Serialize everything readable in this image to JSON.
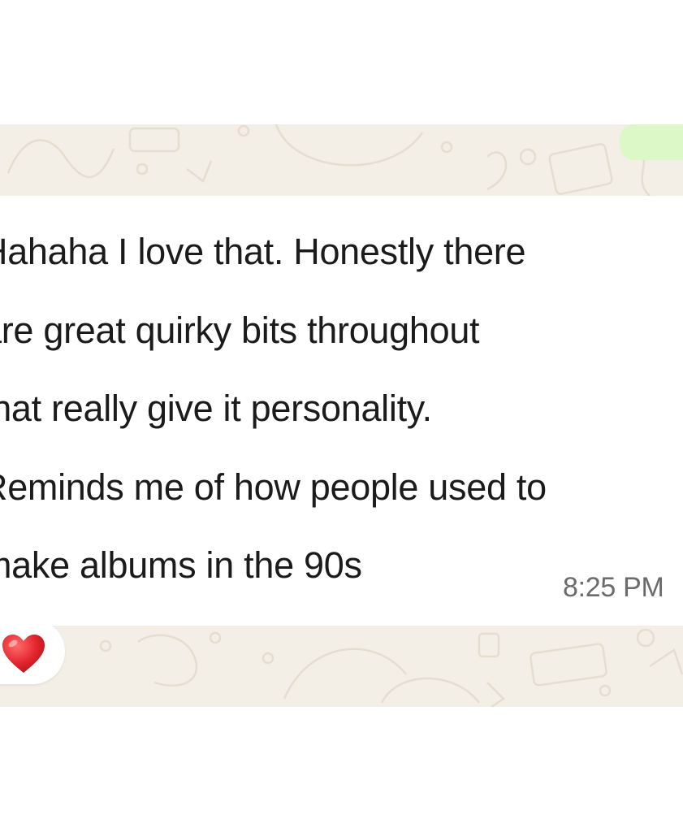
{
  "message": {
    "text": "Hahaha I love that. Honestly there\nare great quirky bits throughout\nthat really give it personality.\nReminds me of how people used to\nmake albums in the 90s",
    "time": "8:25 PM"
  },
  "reaction": {
    "icon": "red-heart-icon",
    "color": "#e3262e"
  },
  "colors": {
    "chat_background": "#f3efe6",
    "outgoing_bubble": "#dcf8c6",
    "incoming_bubble": "#ffffff"
  }
}
